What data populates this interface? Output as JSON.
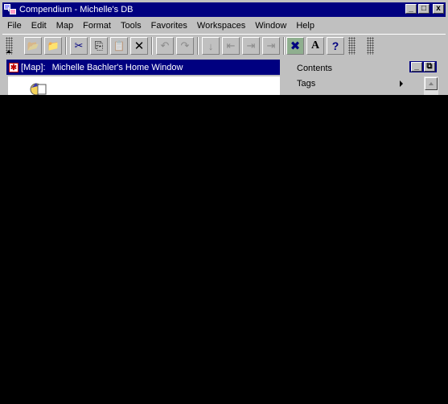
{
  "window": {
    "title": "Compendium - Michelle's DB",
    "buttons": {
      "minimize": "_",
      "maximize": "□",
      "close": "x"
    }
  },
  "menubar": {
    "items": [
      "File",
      "Edit",
      "Map",
      "Format",
      "Tools",
      "Favorites",
      "Workspaces",
      "Window",
      "Help"
    ]
  },
  "toolbar": {
    "buttons": [
      {
        "name": "open-icon",
        "glyph": "📂",
        "enabled": false
      },
      {
        "name": "save-icon",
        "glyph": "📁",
        "enabled": true
      },
      {
        "name": "cut-icon",
        "glyph": "✂",
        "enabled": true
      },
      {
        "name": "copy-icon",
        "glyph": "⎘",
        "enabled": true
      },
      {
        "name": "paste-icon",
        "glyph": "📋",
        "enabled": false
      },
      {
        "name": "delete-icon",
        "glyph": "✕",
        "enabled": true
      },
      {
        "name": "undo-icon",
        "glyph": "↶",
        "enabled": false
      },
      {
        "name": "redo-icon",
        "glyph": "↷",
        "enabled": false
      },
      {
        "name": "arrow-down-icon",
        "glyph": "↓",
        "enabled": false
      },
      {
        "name": "arrow-left-icon",
        "glyph": "⇤",
        "enabled": false
      },
      {
        "name": "arrow-right-icon",
        "glyph": "⇥",
        "enabled": false
      },
      {
        "name": "arrow-end-icon",
        "glyph": "⇥",
        "enabled": false
      },
      {
        "name": "map-node-icon",
        "glyph": "✖",
        "enabled": true
      },
      {
        "name": "find-icon",
        "glyph": "A",
        "enabled": true
      },
      {
        "name": "help-icon",
        "glyph": "?",
        "enabled": true
      }
    ]
  },
  "map_window": {
    "prefix": "[Map]:",
    "title": "Michelle Bachler's Home Window"
  },
  "dropdown": {
    "items": [
      {
        "label": "Contents",
        "submenu": false
      },
      {
        "label": "Tags",
        "submenu": true
      }
    ]
  }
}
